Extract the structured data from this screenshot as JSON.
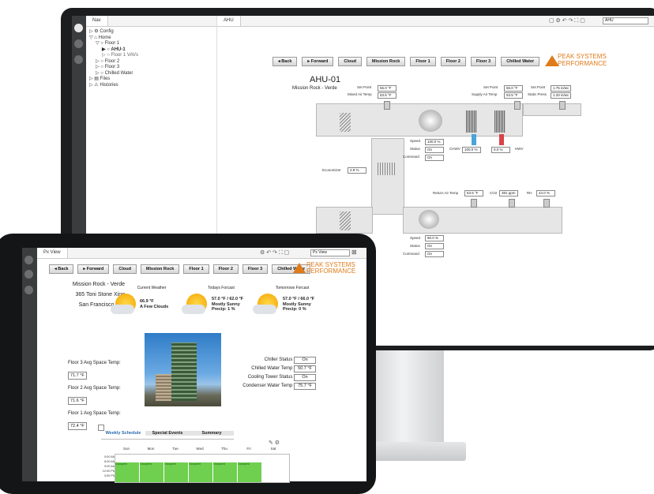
{
  "monitor": {
    "nav_tab": "Nav",
    "tree": [
      "Config",
      "Home",
      "Floor 1",
      "AHU-1",
      "Floor 1 VAVs",
      "Floor 2",
      "Floor 3",
      "Chilled Water",
      "Files",
      "Histories"
    ],
    "main_tab": "AHU",
    "toolbar_select": "AHU",
    "buttons": [
      "Back",
      "Forward",
      "Cloud",
      "Mission Rock",
      "Floor 1",
      "Floor 2",
      "Floor 3",
      "Chilled Water"
    ],
    "brand_line1": "PEAK SYSTEMS",
    "brand_line2": "PERFORMANCE",
    "title": "AHU-01",
    "subtitle": "Mission Rock - Verde",
    "points": {
      "set_point_1_label": "Set Point",
      "set_point_1_value": "55.0 °F",
      "mixed_air_label": "Mixed Air Temp",
      "mixed_air_value": "53.5 °F",
      "set_point_2_label": "Set Point",
      "set_point_2_value": "55.0 °F",
      "supply_air_label": "Supply Air Temp",
      "supply_air_value": "53.5 °F",
      "set_point_3_label": "Set Point",
      "set_point_3_value": "1.75 in/wc",
      "static_press_label": "Static Press",
      "static_press_value": "1.33 in/wc",
      "speed_label": "Speed",
      "speed_value": "100.0 %",
      "status_label": "Status",
      "status_value": "On",
      "command_label": "Command",
      "command_value": "On",
      "chwv_label": "CHWV",
      "chwv_value": "100.0 %",
      "hwv_value": "0.0 %",
      "hwv_label": "HWV",
      "economizer_label": "Economizer",
      "economizer_value": "2.9 %",
      "return_air_label": "Return Air Temp",
      "return_air_value": "53.5 °F",
      "co2_label": "CO2",
      "co2_value": "381 ppm",
      "rh_label": "RH",
      "rh_value": "44.0 %",
      "speed2_label": "Speed",
      "speed2_value": "90.0 %",
      "status2_label": "Status",
      "status2_value": "On",
      "command2_label": "Command",
      "command2_value": "On"
    }
  },
  "tablet": {
    "tab": "Px View",
    "toolbar_select": "Px View",
    "buttons": [
      "Back",
      "Forward",
      "Cloud",
      "Mission Rock",
      "Floor 1",
      "Floor 2",
      "Floor 3",
      "Chilled Water"
    ],
    "brand_line1": "PEAK SYSTEMS",
    "brand_line2": "PERFORMANCE",
    "address": [
      "Mission Rock - Verde",
      "365 Toni Stone Xing",
      "San Francisco, CA"
    ],
    "weather": [
      {
        "heading": "Current Weather",
        "line1": "66.9 °F",
        "line2": "A Few Clouds",
        "line3": ""
      },
      {
        "heading": "Todays Forcast",
        "line1": "57.0 °F / 62.0 °F",
        "line2": "Mostly Sunny",
        "line3": "Precip: 1 %"
      },
      {
        "heading": "Tomorrows Forcast",
        "line1": "57.0 °F / 66.0 °F",
        "line2": "Mostly Sunny",
        "line3": "Precip: 0 %"
      }
    ],
    "floors": [
      {
        "label": "Floor 3 Avg Space Temp:",
        "value": "71.7 °F"
      },
      {
        "label": "Floor 2 Avg Space Temp:",
        "value": "71.6 °F"
      },
      {
        "label": "Floor 1 Avg Space Temp:",
        "value": "72.4 °F"
      }
    ],
    "plant": [
      {
        "label": "Chiller Status",
        "value": "On"
      },
      {
        "label": "Chilled Water Temp",
        "value": "50.7 °F"
      },
      {
        "label": "Cooling Tower Status",
        "value": "On"
      },
      {
        "label": "Condenser Water Temp",
        "value": "75.7 °F"
      }
    ],
    "schedule_tabs": [
      "Weekly Schedule",
      "Special Events",
      "Summary"
    ],
    "days": [
      "Sun",
      "Mon",
      "Tue",
      "Wed",
      "Thu",
      "Fri",
      "Sat"
    ],
    "times": [
      "0:00 AM",
      "6:00 AM",
      "9:00 AM",
      "12:00 PM",
      "3:00 PM"
    ],
    "occupied": "Occupied"
  }
}
